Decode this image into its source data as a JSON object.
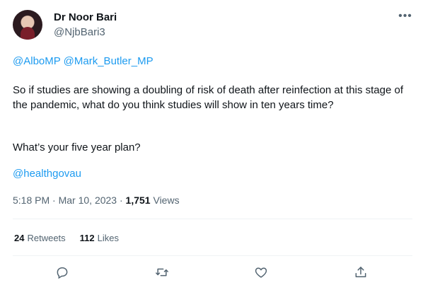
{
  "author": {
    "display_name": "Dr Noor Bari",
    "handle": "@NjbBari3"
  },
  "tweet": {
    "mention_1": "@AlboMP",
    "mention_2": "@Mark_Butler_MP",
    "body": "So if studies are showing a doubling of risk of death after reinfection at this stage of the pandemic, what do you think studies will show in ten years time?",
    "question": "What’s your five year plan?",
    "hashtag": "@healthgovau"
  },
  "meta": {
    "time": "5:18 PM",
    "separator": "·",
    "date": "Mar 10, 2023",
    "views_count": "1,751",
    "views_label": "Views"
  },
  "stats": {
    "retweets_count": "24",
    "retweets_label": "Retweets",
    "likes_count": "112",
    "likes_label": "Likes"
  },
  "icons": {
    "more": "more-icon",
    "reply": "reply-icon",
    "retweet": "retweet-icon",
    "like": "heart-icon",
    "share": "share-icon"
  }
}
